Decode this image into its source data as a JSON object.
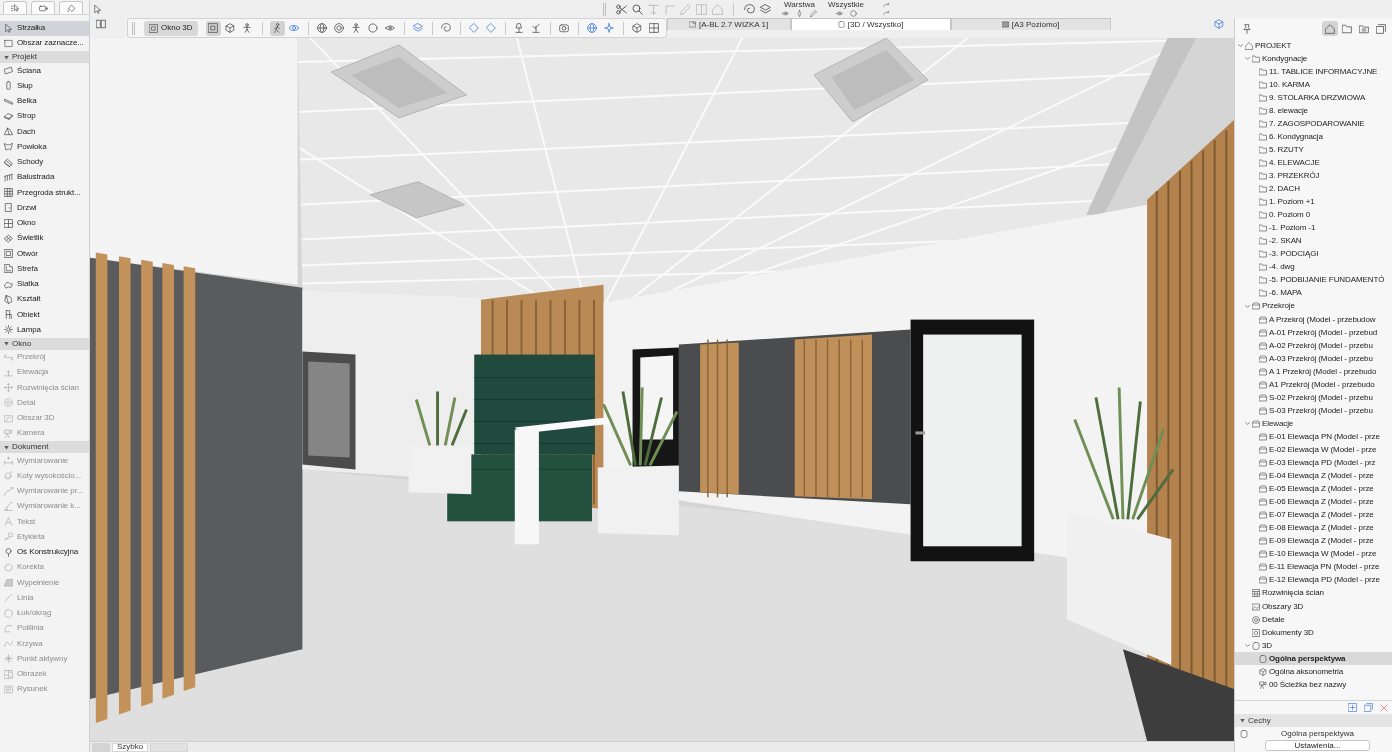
{
  "toolbox": {
    "pointer_tools": [
      {
        "label": "Strzałka",
        "selected": true
      },
      {
        "label": "Obszar zaznacze...",
        "selected": false
      }
    ],
    "sections": [
      {
        "title": "Projekt",
        "expanded": true,
        "tools": [
          {
            "label": "Ściana",
            "disabled": false,
            "selected": false
          },
          {
            "label": "Słup",
            "disabled": false,
            "selected": false
          },
          {
            "label": "Belka",
            "disabled": false,
            "selected": false
          },
          {
            "label": "Strop",
            "disabled": false,
            "selected": false
          },
          {
            "label": "Dach",
            "disabled": false,
            "selected": false
          },
          {
            "label": "Powłoka",
            "disabled": false,
            "selected": false
          },
          {
            "label": "Schody",
            "disabled": false,
            "selected": false
          },
          {
            "label": "Balustrada",
            "disabled": false,
            "selected": false
          },
          {
            "label": "Przegroda strukt...",
            "disabled": false,
            "selected": false
          },
          {
            "label": "Drzwi",
            "disabled": false,
            "selected": false
          },
          {
            "label": "Okno",
            "disabled": false,
            "selected": false
          },
          {
            "label": "Świetlik",
            "disabled": false,
            "selected": false
          },
          {
            "label": "Otwór",
            "disabled": false,
            "selected": false
          },
          {
            "label": "Strefa",
            "disabled": false,
            "selected": false
          },
          {
            "label": "Siatka",
            "disabled": false,
            "selected": false
          },
          {
            "label": "Kształt",
            "disabled": false,
            "selected": false
          },
          {
            "label": "Obiekt",
            "disabled": false,
            "selected": false
          },
          {
            "label": "Lampa",
            "disabled": false,
            "selected": false
          }
        ]
      },
      {
        "title": "Okno",
        "expanded": true,
        "tools": [
          {
            "label": "Przekrój",
            "disabled": true,
            "selected": false
          },
          {
            "label": "Elewacja",
            "disabled": true,
            "selected": false
          },
          {
            "label": "Rozwinięcia ścian",
            "disabled": true,
            "selected": false
          },
          {
            "label": "Detal",
            "disabled": true,
            "selected": false
          },
          {
            "label": "Obszar 3D",
            "disabled": true,
            "selected": false
          },
          {
            "label": "Kamera",
            "disabled": true,
            "selected": false
          }
        ]
      },
      {
        "title": "Dokument",
        "expanded": true,
        "tools": [
          {
            "label": "Wymiarowanie",
            "disabled": true,
            "selected": false
          },
          {
            "label": "Koty wysokościo...",
            "disabled": true,
            "selected": false
          },
          {
            "label": "Wymiarowanie pr...",
            "disabled": true,
            "selected": false
          },
          {
            "label": "Wymiarowanie k...",
            "disabled": true,
            "selected": false
          },
          {
            "label": "Tekst",
            "disabled": true,
            "selected": false
          },
          {
            "label": "Etykieta",
            "disabled": true,
            "selected": false
          },
          {
            "label": "Oś Konstrukcyjna",
            "disabled": false,
            "selected": false
          },
          {
            "label": "Korekta",
            "disabled": true,
            "selected": false
          },
          {
            "label": "Wypełnienie",
            "disabled": true,
            "selected": false
          },
          {
            "label": "Linia",
            "disabled": true,
            "selected": false
          },
          {
            "label": "Łuk/okrąg",
            "disabled": true,
            "selected": false
          },
          {
            "label": "Polilinia",
            "disabled": true,
            "selected": false
          },
          {
            "label": "Krzywa",
            "disabled": true,
            "selected": false
          },
          {
            "label": "Punkt aktywny",
            "disabled": true,
            "selected": false
          },
          {
            "label": "Obrazek",
            "disabled": true,
            "selected": false
          },
          {
            "label": "Rysunek",
            "disabled": true,
            "selected": false
          }
        ]
      }
    ]
  },
  "edit_toolbar": {
    "tools": [
      {
        "disabled": false
      },
      {
        "disabled": false
      },
      {
        "disabled": true
      },
      {
        "disabled": true
      },
      {
        "disabled": true
      },
      {
        "disabled": true
      },
      {
        "disabled": true
      }
    ],
    "layer_label": "Warstwa",
    "visibility_label": "Wszystkie"
  },
  "view_toolbar": {
    "window_label": "Okno 3D",
    "projection_modes": [
      {
        "selected": true
      },
      {
        "selected": false
      },
      {
        "selected": false
      }
    ],
    "navigation_modes": [
      {
        "selected": true
      },
      {
        "selected": false
      }
    ]
  },
  "view_tabs": [
    {
      "label": "[A-BL 2.7 WIZKA 1]",
      "selected": false
    },
    {
      "label": "[3D / Wszystko]",
      "selected": true
    },
    {
      "label": "[A3 Poziomo]",
      "selected": false
    }
  ],
  "status_bar": {
    "fields": [
      "Szybko"
    ]
  },
  "navigator": {
    "map_tabs": [
      {
        "selected": true
      },
      {
        "selected": false
      },
      {
        "selected": false
      },
      {
        "selected": false
      }
    ],
    "tree": [
      {
        "label": "PROJEKT",
        "kind": "project",
        "selected": false,
        "expanded": true,
        "children": [
          {
            "label": "Kondygnacje",
            "kind": "stories",
            "selected": false,
            "expanded": true,
            "children": [
              {
                "label": "11. TABLICE INFORMACYJNE",
                "kind": "story",
                "selected": false
              },
              {
                "label": "10. KARMA",
                "kind": "story",
                "selected": false
              },
              {
                "label": "9. STOLARKA DRZWIOWA",
                "kind": "story",
                "selected": false
              },
              {
                "label": "8. elewacje",
                "kind": "story",
                "selected": false
              },
              {
                "label": "7. ZAGOSPODAROWANIE",
                "kind": "story",
                "selected": false
              },
              {
                "label": "6. Kondygnacja",
                "kind": "story",
                "selected": false
              },
              {
                "label": "5. RZUTY",
                "kind": "story",
                "selected": false
              },
              {
                "label": "4. ELEWACJE",
                "kind": "story",
                "selected": false
              },
              {
                "label": "3. PRZEKRÓJ",
                "kind": "story",
                "selected": false
              },
              {
                "label": "2. DACH",
                "kind": "story",
                "selected": false
              },
              {
                "label": "1. Poziom +1",
                "kind": "story",
                "selected": false
              },
              {
                "label": "0. Poziom 0",
                "kind": "story",
                "selected": false
              },
              {
                "label": "-1. Poziom -1",
                "kind": "story",
                "selected": false
              },
              {
                "label": "-2. SKAN",
                "kind": "story",
                "selected": false
              },
              {
                "label": "-3. PODCIĄGI",
                "kind": "story",
                "selected": false
              },
              {
                "label": "-4. dwg",
                "kind": "story",
                "selected": false
              },
              {
                "label": "-5. PODBIJANIE FUNDAMENTÓ",
                "kind": "story",
                "selected": false
              },
              {
                "label": "-6. MAPA",
                "kind": "story",
                "selected": false
              }
            ]
          },
          {
            "label": "Przekroje",
            "kind": "sections",
            "selected": false,
            "expanded": true,
            "children": [
              {
                "label": "A Przekrój (Model - przebudow",
                "kind": "section",
                "selected": false
              },
              {
                "label": "A-01 Przekrój (Model - przebud",
                "kind": "section",
                "selected": false
              },
              {
                "label": "A-02 Przekrój (Model - przebu",
                "kind": "section",
                "selected": false
              },
              {
                "label": "A-03 Przekrój (Model - przebu",
                "kind": "section",
                "selected": false
              },
              {
                "label": "A 1 Przekrój (Model - przebudo",
                "kind": "section",
                "selected": false
              },
              {
                "label": "A1 Przekrój (Model - przebudo",
                "kind": "section",
                "selected": false
              },
              {
                "label": "S-02 Przekrój (Model - przebu",
                "kind": "section",
                "selected": false
              },
              {
                "label": "S-03 Przekrój (Model - przebu",
                "kind": "section",
                "selected": false
              }
            ]
          },
          {
            "label": "Elewacje",
            "kind": "elevations",
            "selected": false,
            "expanded": true,
            "children": [
              {
                "label": "E-01 Elewacja PN (Model - prze",
                "kind": "elevation",
                "selected": false
              },
              {
                "label": "E-02 Elewacja W (Model - prze",
                "kind": "elevation",
                "selected": false
              },
              {
                "label": "E-03 Elewacja PD (Model - prz",
                "kind": "elevation",
                "selected": false
              },
              {
                "label": "E-04 Elewacja Z (Model - prze",
                "kind": "elevation",
                "selected": false
              },
              {
                "label": "E-05 Elewacja Z (Model - prze",
                "kind": "elevation",
                "selected": false
              },
              {
                "label": "E-06 Elewacja Z (Model - prze",
                "kind": "elevation",
                "selected": false
              },
              {
                "label": "E-07 Elewacja Z (Model - prze",
                "kind": "elevation",
                "selected": false
              },
              {
                "label": "E-08 Elewacja Z (Model - prze",
                "kind": "elevation",
                "selected": false
              },
              {
                "label": "E-09 Elewacja Z (Model - prze",
                "kind": "elevation",
                "selected": false
              },
              {
                "label": "E-10 Elewacja W (Model - prze",
                "kind": "elevation",
                "selected": false
              },
              {
                "label": "E-11 Elewacja PN (Model - prze",
                "kind": "elevation",
                "selected": false
              },
              {
                "label": "E-12 Elewacja PD (Model - prze",
                "kind": "elevation",
                "selected": false
              }
            ]
          },
          {
            "label": "Rozwinięcia ścian",
            "kind": "interior",
            "selected": false
          },
          {
            "label": "Obszary 3D",
            "kind": "worksheets",
            "selected": false
          },
          {
            "label": "Detale",
            "kind": "details",
            "selected": false
          },
          {
            "label": "Dokumenty 3D",
            "kind": "documents",
            "selected": false
          },
          {
            "label": "3D",
            "kind": "views3d",
            "selected": false,
            "expanded": true,
            "children": [
              {
                "label": "Ogólna perspektywa",
                "kind": "perspective",
                "selected": true
              },
              {
                "label": "Ogólna aksonometria",
                "kind": "axonometry",
                "selected": false
              },
              {
                "label": "00 Ścieżka bez nazwy",
                "kind": "path",
                "selected": false
              }
            ]
          }
        ]
      }
    ],
    "properties": {
      "title": "Cechy",
      "expanded": true,
      "view_name": "Ogólna perspektywa",
      "settings_button": "Ustawienia..."
    }
  }
}
